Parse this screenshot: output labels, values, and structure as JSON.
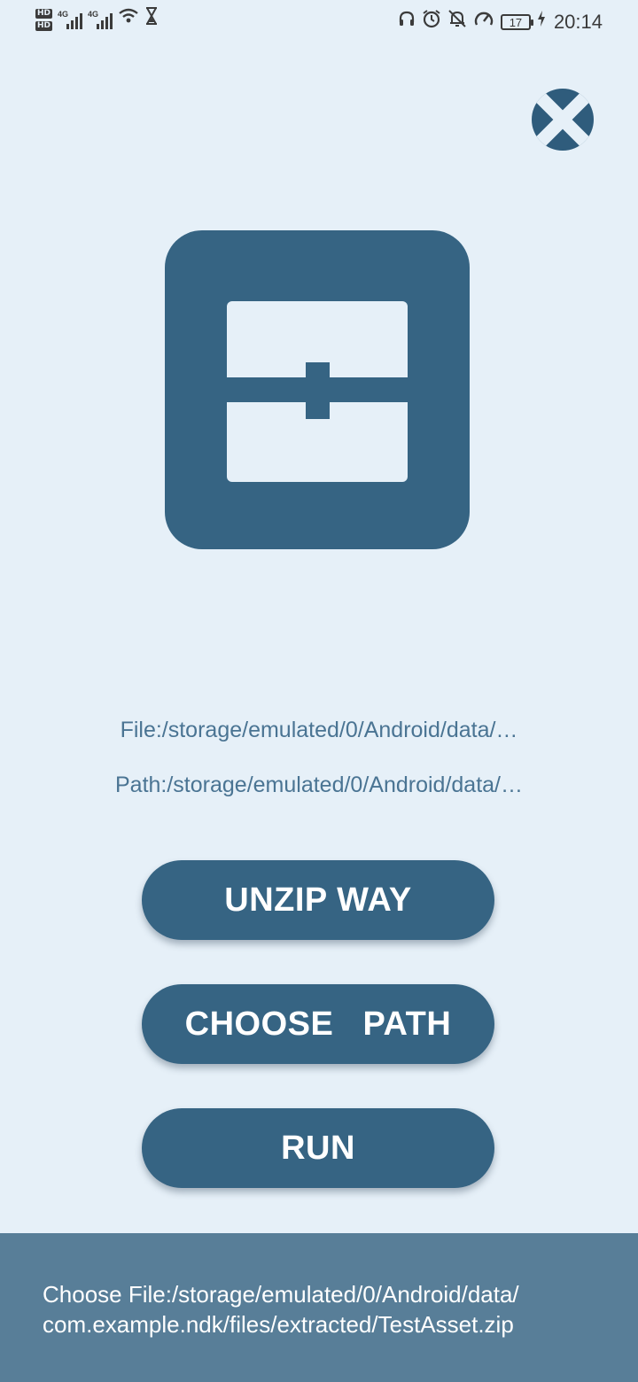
{
  "status_bar": {
    "network_left": "HD",
    "net_type": "4G",
    "battery": "17",
    "time": "20:14",
    "icons": [
      "hd-icon",
      "signal-icon",
      "signal-icon",
      "wifi-icon",
      "hourglass-icon",
      "headphones-icon",
      "alarm-icon",
      "mute-icon",
      "speedometer-icon",
      "battery-icon"
    ]
  },
  "close_button": {
    "icon": "close-icon"
  },
  "logo": {
    "icon": "toolbox-icon"
  },
  "info": {
    "file": "File:/storage/emulated/0/Android/data/…",
    "path": "Path:/storage/emulated/0/Android/data/…"
  },
  "buttons": {
    "unzip": "UNZIP WAY",
    "choose": "CHOOSE   PATH",
    "run": "RUN"
  },
  "bottom": {
    "line1": "Choose File:/storage/emulated/0/Android/data/",
    "line2": "com.example.ndk/files/extracted/TestAsset.zip"
  },
  "colors": {
    "background": "#e6f0f8",
    "primary": "#366483",
    "panel": "#587e98",
    "info_text": "#4a7493"
  }
}
